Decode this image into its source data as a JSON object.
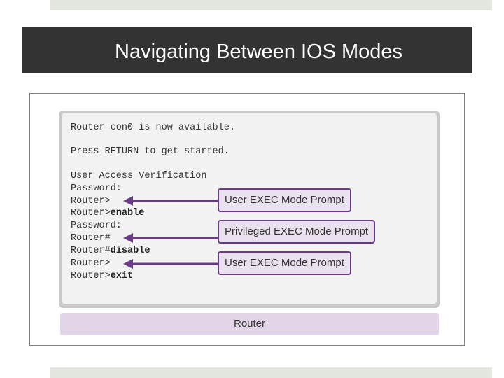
{
  "slide": {
    "title": "Navigating Between IOS Modes"
  },
  "console": {
    "lines": [
      {
        "prefix": "Router con0 is now available.",
        "command": ""
      },
      {
        "prefix": "Press RETURN to get started.",
        "command": ""
      },
      {
        "prefix": "User Access Verification",
        "command": ""
      },
      {
        "prefix": "Password:",
        "command": ""
      },
      {
        "prefix": "Router>",
        "command": ""
      },
      {
        "prefix": "Router>",
        "command": "enable"
      },
      {
        "prefix": "Password:",
        "command": ""
      },
      {
        "prefix": "Router#",
        "command": ""
      },
      {
        "prefix": "Router#",
        "command": "disable"
      },
      {
        "prefix": "Router>",
        "command": ""
      },
      {
        "prefix": "Router>",
        "command": "exit"
      }
    ]
  },
  "callouts": [
    {
      "label": "User EXEC Mode Prompt"
    },
    {
      "label": "Privileged EXEC Mode Prompt"
    },
    {
      "label": "User EXEC Mode Prompt"
    }
  ],
  "router_label": "Router",
  "colors": {
    "title_bar": "#333333",
    "accent_purple": "#6b3a86",
    "callout_fill": "#eae1ee",
    "router_bar": "#e1d5e7"
  }
}
